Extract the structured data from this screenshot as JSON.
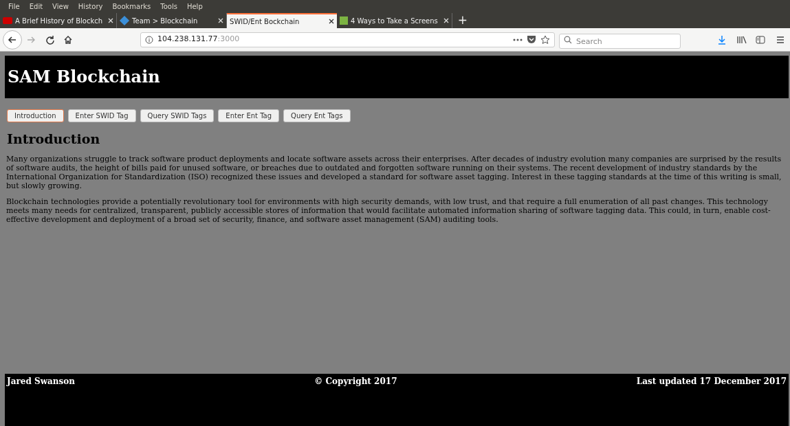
{
  "menu_bar": [
    "File",
    "Edit",
    "View",
    "History",
    "Bookmarks",
    "Tools",
    "Help"
  ],
  "tabs": [
    {
      "label": "A Brief History of Blockch",
      "selected": false,
      "kind": "hbr"
    },
    {
      "label": "Team > Blockchain",
      "selected": false,
      "kind": "team"
    },
    {
      "label": "SWID/Ent Bockchain",
      "selected": true,
      "kind": "none"
    },
    {
      "label": "4 Ways to Take a Screens",
      "selected": false,
      "kind": "wh"
    }
  ],
  "new_tab": "+",
  "address": {
    "host": "104.238.131.77",
    "port": ":3000"
  },
  "search": {
    "placeholder": "Search"
  },
  "page": {
    "title": "SAM Blockchain",
    "nav": [
      {
        "label": "Introduction",
        "selected": true
      },
      {
        "label": "Enter SWID Tag",
        "selected": false
      },
      {
        "label": "Query SWID Tags",
        "selected": false
      },
      {
        "label": "Enter Ent Tag",
        "selected": false
      },
      {
        "label": "Query Ent Tags",
        "selected": false
      }
    ],
    "heading": "Introduction",
    "paragraphs": [
      "Many organizations struggle to track software product deployments and locate software assets across their enterprises. After decades of industry evolution many companies are surprised by the results of software audits, the height of bills paid for unused software, or breaches due to outdated and forgotten software running on their systems. The recent development of industry standards by the International Organization for Standardization (ISO) recognized these issues and developed a standard for software asset tagging. Interest in these tagging standards at the time of this writing is small, but slowly growing.",
      "Blockchain technologies provide a potentially revolutionary tool for environments with high security demands, with low trust, and that require a full enumeration of all past changes. This technology meets many needs for centralized, transparent, publicly accessible stores of information that would facilitate automated information sharing of software tagging data. This could, in turn, enable cost-effective development and deployment of a broad set of security, finance, and software asset management (SAM) auditing tools."
    ],
    "footer": {
      "author": "Jared Swanson",
      "copyright": "© Copyright 2017",
      "updated": "Last updated 17 December 2017"
    }
  }
}
